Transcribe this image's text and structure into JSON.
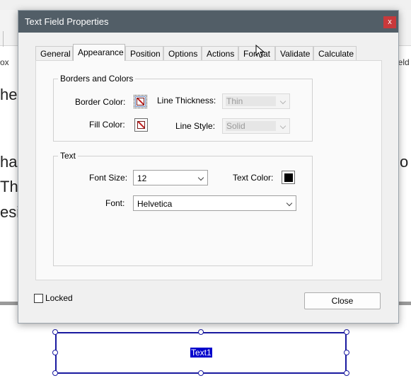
{
  "background": {
    "left_tool": "ox",
    "right_tool": "ield",
    "text_lines": [
      "he",
      "ha",
      "Th",
      "esi",
      "o"
    ]
  },
  "dialog": {
    "title": "Text Field Properties",
    "close_glyph": "x",
    "tabs": [
      "General",
      "Appearance",
      "Position",
      "Options",
      "Actions",
      "Format",
      "Validate",
      "Calculate"
    ],
    "active_tab": "Appearance",
    "borders_group": {
      "title": "Borders and Colors",
      "border_color_label": "Border Color:",
      "fill_color_label": "Fill Color:",
      "line_thickness_label": "Line Thickness:",
      "line_thickness_value": "Thin",
      "line_style_label": "Line Style:",
      "line_style_value": "Solid"
    },
    "text_group": {
      "title": "Text",
      "font_size_label": "Font Size:",
      "font_size_value": "12",
      "text_color_label": "Text Color:",
      "text_color": "#000000",
      "font_label": "Font:",
      "font_value": "Helvetica"
    },
    "locked_label": "Locked",
    "locked_checked": false,
    "close_button": "Close"
  },
  "form_field": {
    "name": "Text1"
  },
  "colors": {
    "titlebar": "#525e67",
    "close_button_red": "#c8393b",
    "field_border": "#1a1aa0",
    "field_label_bg": "#0000cc"
  }
}
